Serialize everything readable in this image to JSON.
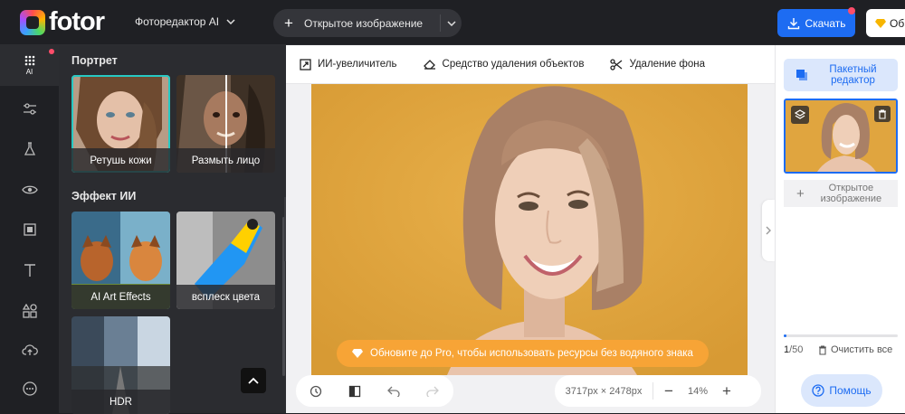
{
  "brand": {
    "name": "fotor"
  },
  "header": {
    "editor_select": "Фоторедактор AI",
    "open_image": "Открытое изображение",
    "download": "Скачать",
    "pro": "Об"
  },
  "sidebar": {
    "ai_label": "AI"
  },
  "panel": {
    "section_portrait": "Портрет",
    "section_ai": "Эффект ИИ",
    "tiles": [
      {
        "label": "Ретушь кожи"
      },
      {
        "label": "Размыть лицо"
      },
      {
        "label": "AI Art Effects"
      },
      {
        "label": "всплеск цвета"
      },
      {
        "label": "HDR"
      }
    ]
  },
  "tools": {
    "upscaler": "ИИ-увеличитель",
    "object_remover": "Средство удаления объектов",
    "bg_remover": "Удаление фона"
  },
  "canvas": {
    "upgrade_banner": "Обновите до Pro, чтобы использовать ресурсы без водяного знака",
    "dimensions": "3717px × 2478px",
    "zoom": "14%"
  },
  "right_panel": {
    "batch_editor_line1": "Пакетный",
    "batch_editor_line2": "редактор",
    "open_image_line1": "Открытое",
    "open_image_line2": "изображение",
    "count_current": "1",
    "count_total": "/50",
    "clear_all": "Очистить все",
    "help": "Помощь",
    "progress": 0.02
  },
  "colors": {
    "accent": "#1d6cf2",
    "teal": "#27c9c3",
    "upgrade": "#f7a436",
    "photo_bg": "#e0a53f"
  }
}
